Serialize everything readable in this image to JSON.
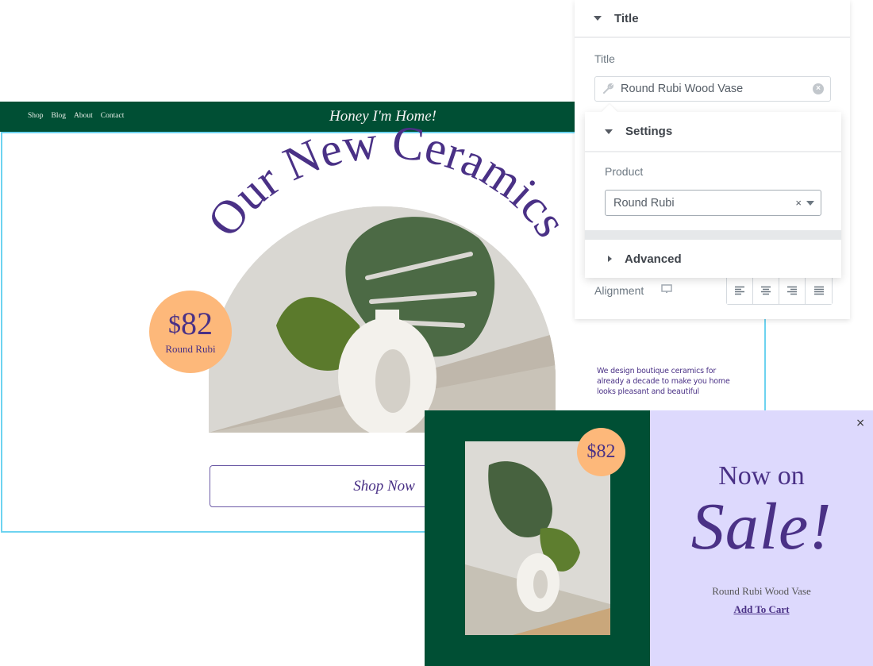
{
  "site": {
    "nav_links": [
      "Shop",
      "Blog",
      "About",
      "Contact"
    ],
    "brand": "Honey I'm Home!",
    "headline": "Our New Ceramics",
    "price_badge": {
      "currency": "$",
      "amount": "82",
      "product": "Round Rubi"
    },
    "cta_label": "Shop Now",
    "tagline": "We design boutique ceramics for already a decade to make you home looks pleasant and beautiful",
    "colors": {
      "brand_green": "#004f34",
      "accent_purple": "#4a3186",
      "badge_orange": "#fdb87a",
      "selection_outline": "#6dd3f0"
    }
  },
  "editor": {
    "title_section": {
      "header": "Title",
      "field_label": "Title",
      "field_value": "Round Rubi Wood Vase",
      "icon": "wrench-icon"
    },
    "settings_section": {
      "header": "Settings",
      "product_label": "Product",
      "product_value": "Round Rubi"
    },
    "advanced_section": {
      "header": "Advanced"
    },
    "alignment": {
      "label": "Alignment",
      "options": [
        "left",
        "center",
        "right",
        "justify"
      ]
    }
  },
  "popup": {
    "price": "$82",
    "line1": "Now on",
    "line2": "Sale!",
    "product_name": "Round Rubi Wood Vase",
    "cta_label": "Add To Cart",
    "close_symbol": "×",
    "colors": {
      "left_bg": "#004f34",
      "right_bg": "#ddd9fd"
    }
  }
}
